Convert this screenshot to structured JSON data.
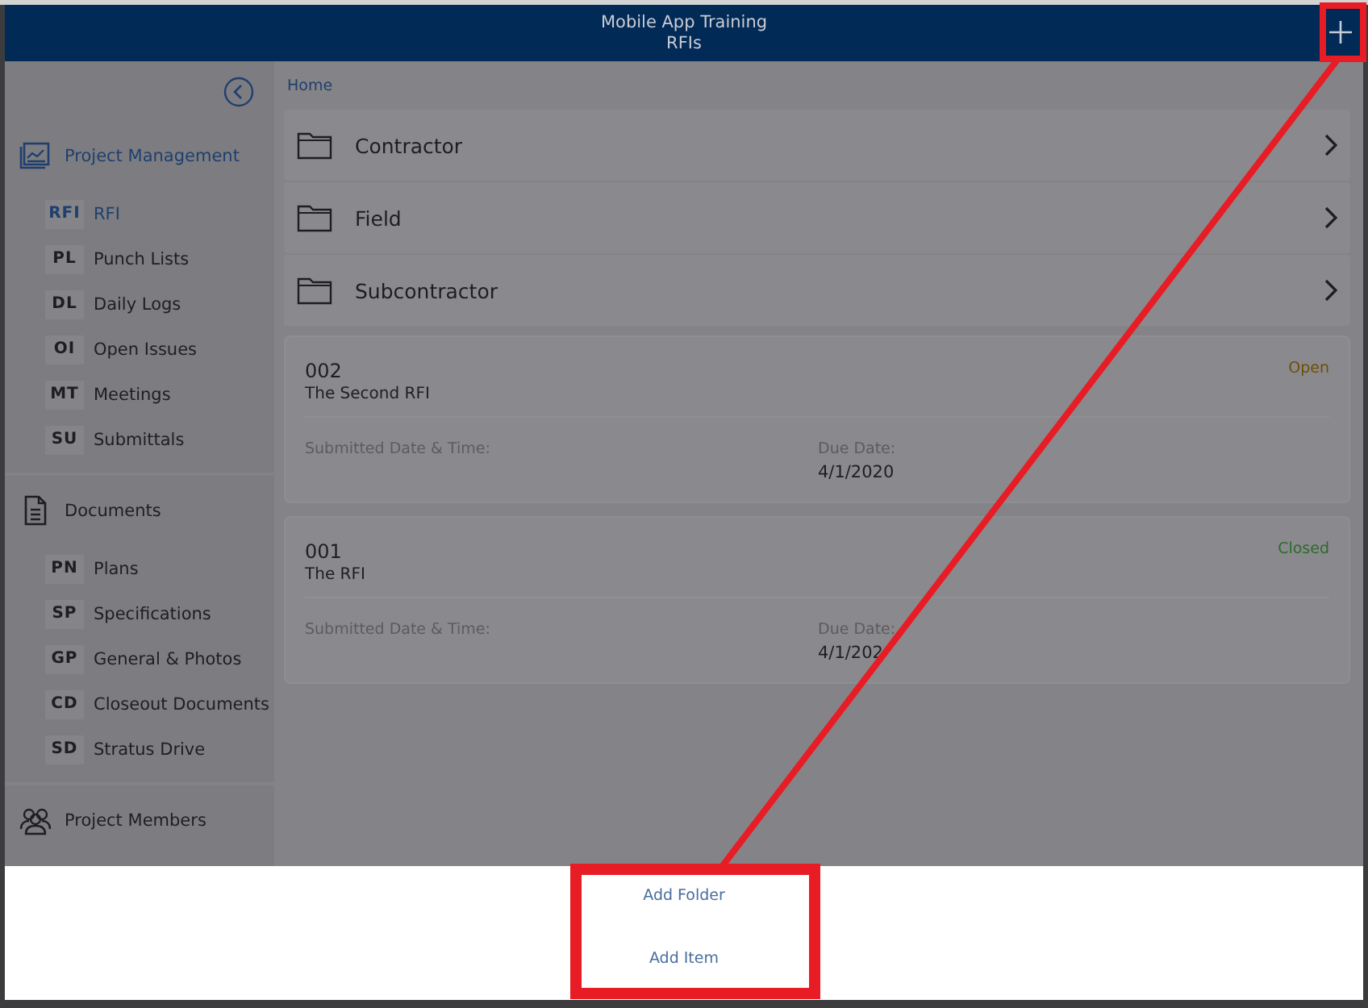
{
  "header": {
    "title": "Mobile App Training",
    "subtitle": "RFIs"
  },
  "sidebar": {
    "sections": [
      {
        "title": "Project Management",
        "kind": "chart",
        "items": [
          {
            "code": "RFI",
            "label": "RFI",
            "selected": true
          },
          {
            "code": "PL",
            "label": "Punch Lists",
            "selected": false
          },
          {
            "code": "DL",
            "label": "Daily Logs",
            "selected": false
          },
          {
            "code": "OI",
            "label": "Open Issues",
            "selected": false
          },
          {
            "code": "MT",
            "label": "Meetings",
            "selected": false
          },
          {
            "code": "SU",
            "label": "Submittals",
            "selected": false
          }
        ]
      },
      {
        "title": "Documents",
        "kind": "document",
        "items": [
          {
            "code": "PN",
            "label": "Plans",
            "selected": false
          },
          {
            "code": "SP",
            "label": "Specifications",
            "selected": false
          },
          {
            "code": "GP",
            "label": "General & Photos",
            "selected": false
          },
          {
            "code": "CD",
            "label": "Closeout Documents",
            "selected": false
          },
          {
            "code": "SD",
            "label": "Stratus Drive",
            "selected": false
          }
        ]
      },
      {
        "title": "Project Members",
        "kind": "people"
      }
    ]
  },
  "breadcrumb": "Home",
  "folders": [
    {
      "name": "Contractor"
    },
    {
      "name": "Field"
    },
    {
      "name": "Subcontractor"
    }
  ],
  "rfis": [
    {
      "number": "002",
      "title": "The Second RFI",
      "status": "Open",
      "color": "#6e4f08",
      "submitted_label": "Submitted Date & Time:",
      "due_label": "Due Date:",
      "due": "4/1/2020"
    },
    {
      "number": "001",
      "title": "The RFI",
      "status": "Closed",
      "color": "#2d6a2d",
      "submitted_label": "Submitted Date & Time:",
      "due_label": "Due Date:",
      "due": "4/1/202"
    }
  ],
  "action_sheet": {
    "items": [
      "Add Folder",
      "Add Item"
    ]
  }
}
